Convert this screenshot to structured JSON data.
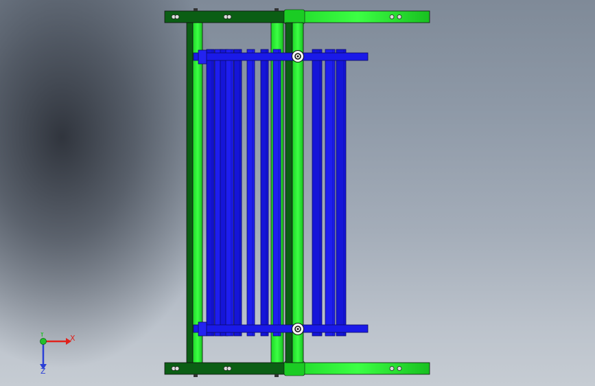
{
  "window": {
    "title": ""
  },
  "view": {
    "background_top": "#7f8a98",
    "background_bottom": "#c6ccd3"
  },
  "model": {
    "colors": {
      "frame_dark_green": "#0b5e14",
      "frame_bright_green": "#22ee2c",
      "slat_blue": "#1a1ae8",
      "slat_dark_blue": "#0a0ab0",
      "outline": "#111111"
    },
    "slat_count": 11
  },
  "triad": {
    "x_label": "X",
    "y_label": "Y",
    "z_label": "Z",
    "x_color": "#e0221c",
    "y_color": "#22c02a",
    "z_color": "#2a3fd6"
  }
}
